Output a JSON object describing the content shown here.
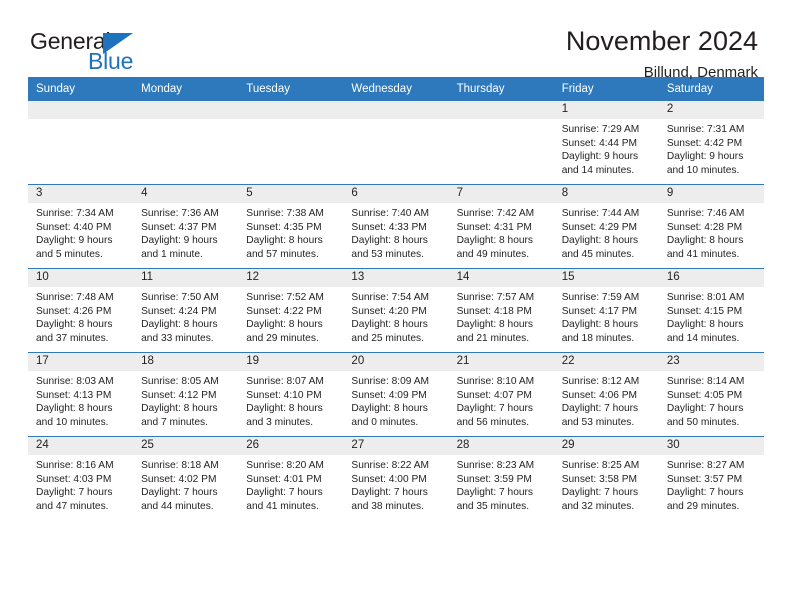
{
  "logo": {
    "word_dark": "General",
    "word_blue": "Blue",
    "triangle_color": "#1f72bd"
  },
  "header": {
    "title": "November 2024",
    "location": "Billund, Denmark",
    "accent_color": "#2e78bc",
    "daynum_band_color": "#ededed"
  },
  "weekday_headers": [
    "Sunday",
    "Monday",
    "Tuesday",
    "Wednesday",
    "Thursday",
    "Friday",
    "Saturday"
  ],
  "weeks": [
    [
      {
        "day": "",
        "empty": true
      },
      {
        "day": "",
        "empty": true
      },
      {
        "day": "",
        "empty": true
      },
      {
        "day": "",
        "empty": true
      },
      {
        "day": "",
        "empty": true
      },
      {
        "day": "1",
        "sunrise": "Sunrise: 7:29 AM",
        "sunset": "Sunset: 4:44 PM",
        "daylight_1": "Daylight: 9 hours",
        "daylight_2": "and 14 minutes."
      },
      {
        "day": "2",
        "sunrise": "Sunrise: 7:31 AM",
        "sunset": "Sunset: 4:42 PM",
        "daylight_1": "Daylight: 9 hours",
        "daylight_2": "and 10 minutes."
      }
    ],
    [
      {
        "day": "3",
        "sunrise": "Sunrise: 7:34 AM",
        "sunset": "Sunset: 4:40 PM",
        "daylight_1": "Daylight: 9 hours",
        "daylight_2": "and 5 minutes."
      },
      {
        "day": "4",
        "sunrise": "Sunrise: 7:36 AM",
        "sunset": "Sunset: 4:37 PM",
        "daylight_1": "Daylight: 9 hours",
        "daylight_2": "and 1 minute."
      },
      {
        "day": "5",
        "sunrise": "Sunrise: 7:38 AM",
        "sunset": "Sunset: 4:35 PM",
        "daylight_1": "Daylight: 8 hours",
        "daylight_2": "and 57 minutes."
      },
      {
        "day": "6",
        "sunrise": "Sunrise: 7:40 AM",
        "sunset": "Sunset: 4:33 PM",
        "daylight_1": "Daylight: 8 hours",
        "daylight_2": "and 53 minutes."
      },
      {
        "day": "7",
        "sunrise": "Sunrise: 7:42 AM",
        "sunset": "Sunset: 4:31 PM",
        "daylight_1": "Daylight: 8 hours",
        "daylight_2": "and 49 minutes."
      },
      {
        "day": "8",
        "sunrise": "Sunrise: 7:44 AM",
        "sunset": "Sunset: 4:29 PM",
        "daylight_1": "Daylight: 8 hours",
        "daylight_2": "and 45 minutes."
      },
      {
        "day": "9",
        "sunrise": "Sunrise: 7:46 AM",
        "sunset": "Sunset: 4:28 PM",
        "daylight_1": "Daylight: 8 hours",
        "daylight_2": "and 41 minutes."
      }
    ],
    [
      {
        "day": "10",
        "sunrise": "Sunrise: 7:48 AM",
        "sunset": "Sunset: 4:26 PM",
        "daylight_1": "Daylight: 8 hours",
        "daylight_2": "and 37 minutes."
      },
      {
        "day": "11",
        "sunrise": "Sunrise: 7:50 AM",
        "sunset": "Sunset: 4:24 PM",
        "daylight_1": "Daylight: 8 hours",
        "daylight_2": "and 33 minutes."
      },
      {
        "day": "12",
        "sunrise": "Sunrise: 7:52 AM",
        "sunset": "Sunset: 4:22 PM",
        "daylight_1": "Daylight: 8 hours",
        "daylight_2": "and 29 minutes."
      },
      {
        "day": "13",
        "sunrise": "Sunrise: 7:54 AM",
        "sunset": "Sunset: 4:20 PM",
        "daylight_1": "Daylight: 8 hours",
        "daylight_2": "and 25 minutes."
      },
      {
        "day": "14",
        "sunrise": "Sunrise: 7:57 AM",
        "sunset": "Sunset: 4:18 PM",
        "daylight_1": "Daylight: 8 hours",
        "daylight_2": "and 21 minutes."
      },
      {
        "day": "15",
        "sunrise": "Sunrise: 7:59 AM",
        "sunset": "Sunset: 4:17 PM",
        "daylight_1": "Daylight: 8 hours",
        "daylight_2": "and 18 minutes."
      },
      {
        "day": "16",
        "sunrise": "Sunrise: 8:01 AM",
        "sunset": "Sunset: 4:15 PM",
        "daylight_1": "Daylight: 8 hours",
        "daylight_2": "and 14 minutes."
      }
    ],
    [
      {
        "day": "17",
        "sunrise": "Sunrise: 8:03 AM",
        "sunset": "Sunset: 4:13 PM",
        "daylight_1": "Daylight: 8 hours",
        "daylight_2": "and 10 minutes."
      },
      {
        "day": "18",
        "sunrise": "Sunrise: 8:05 AM",
        "sunset": "Sunset: 4:12 PM",
        "daylight_1": "Daylight: 8 hours",
        "daylight_2": "and 7 minutes."
      },
      {
        "day": "19",
        "sunrise": "Sunrise: 8:07 AM",
        "sunset": "Sunset: 4:10 PM",
        "daylight_1": "Daylight: 8 hours",
        "daylight_2": "and 3 minutes."
      },
      {
        "day": "20",
        "sunrise": "Sunrise: 8:09 AM",
        "sunset": "Sunset: 4:09 PM",
        "daylight_1": "Daylight: 8 hours",
        "daylight_2": "and 0 minutes."
      },
      {
        "day": "21",
        "sunrise": "Sunrise: 8:10 AM",
        "sunset": "Sunset: 4:07 PM",
        "daylight_1": "Daylight: 7 hours",
        "daylight_2": "and 56 minutes."
      },
      {
        "day": "22",
        "sunrise": "Sunrise: 8:12 AM",
        "sunset": "Sunset: 4:06 PM",
        "daylight_1": "Daylight: 7 hours",
        "daylight_2": "and 53 minutes."
      },
      {
        "day": "23",
        "sunrise": "Sunrise: 8:14 AM",
        "sunset": "Sunset: 4:05 PM",
        "daylight_1": "Daylight: 7 hours",
        "daylight_2": "and 50 minutes."
      }
    ],
    [
      {
        "day": "24",
        "sunrise": "Sunrise: 8:16 AM",
        "sunset": "Sunset: 4:03 PM",
        "daylight_1": "Daylight: 7 hours",
        "daylight_2": "and 47 minutes."
      },
      {
        "day": "25",
        "sunrise": "Sunrise: 8:18 AM",
        "sunset": "Sunset: 4:02 PM",
        "daylight_1": "Daylight: 7 hours",
        "daylight_2": "and 44 minutes."
      },
      {
        "day": "26",
        "sunrise": "Sunrise: 8:20 AM",
        "sunset": "Sunset: 4:01 PM",
        "daylight_1": "Daylight: 7 hours",
        "daylight_2": "and 41 minutes."
      },
      {
        "day": "27",
        "sunrise": "Sunrise: 8:22 AM",
        "sunset": "Sunset: 4:00 PM",
        "daylight_1": "Daylight: 7 hours",
        "daylight_2": "and 38 minutes."
      },
      {
        "day": "28",
        "sunrise": "Sunrise: 8:23 AM",
        "sunset": "Sunset: 3:59 PM",
        "daylight_1": "Daylight: 7 hours",
        "daylight_2": "and 35 minutes."
      },
      {
        "day": "29",
        "sunrise": "Sunrise: 8:25 AM",
        "sunset": "Sunset: 3:58 PM",
        "daylight_1": "Daylight: 7 hours",
        "daylight_2": "and 32 minutes."
      },
      {
        "day": "30",
        "sunrise": "Sunrise: 8:27 AM",
        "sunset": "Sunset: 3:57 PM",
        "daylight_1": "Daylight: 7 hours",
        "daylight_2": "and 29 minutes."
      }
    ]
  ]
}
